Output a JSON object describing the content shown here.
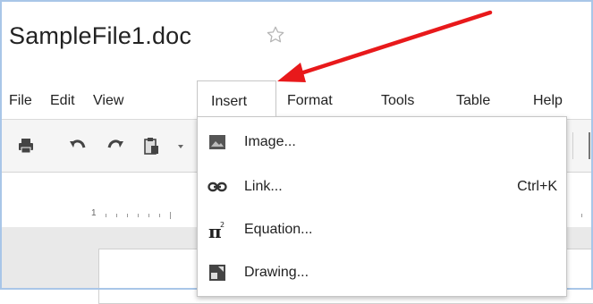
{
  "document": {
    "title": "SampleFile1.doc",
    "star_icon": "star-outline-icon"
  },
  "menubar": {
    "items": [
      {
        "label": "File"
      },
      {
        "label": "Edit"
      },
      {
        "label": "View"
      },
      {
        "label": "Insert",
        "active": true
      },
      {
        "label": "Format"
      },
      {
        "label": "Tools"
      },
      {
        "label": "Table"
      },
      {
        "label": "Help"
      }
    ]
  },
  "toolbar": {
    "icons": [
      "print-icon",
      "undo-icon",
      "redo-icon",
      "paste-format-icon",
      "dropdown-arrow-icon"
    ]
  },
  "ruler": {
    "label": "1"
  },
  "insert_menu": {
    "items": [
      {
        "label": "Image...",
        "icon": "image-icon",
        "shortcut": ""
      },
      {
        "label": "Link...",
        "icon": "link-icon",
        "shortcut": "Ctrl+K"
      },
      {
        "label": "Equation...",
        "icon": "equation-icon",
        "shortcut": ""
      },
      {
        "label": "Drawing...",
        "icon": "drawing-icon",
        "shortcut": ""
      }
    ]
  },
  "colors": {
    "annotation_arrow": "#e8191b",
    "frame_border": "#a9c6e8"
  }
}
